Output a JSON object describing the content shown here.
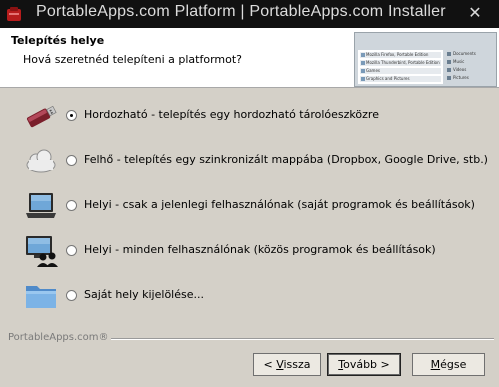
{
  "window": {
    "title": "PortableApps.com Platform | PortableApps.com Installer",
    "close_glyph": "✕"
  },
  "header": {
    "title": "Telepítés helye",
    "subtitle": "Hová szeretnéd telepíteni a platformot?",
    "preview": {
      "items": [
        "Mozilla Firefox, Portable Edition",
        "Mozilla Thunderbird, Portable Edition",
        "Games",
        "Graphics and Pictures"
      ],
      "side_items": [
        "Documents",
        "Music",
        "Videos",
        "Pictures"
      ]
    }
  },
  "options": [
    {
      "id": "portable",
      "label": "Hordozható - telepítés egy hordozható tárolóeszközre",
      "icon": "usb-drive-icon",
      "selected": true
    },
    {
      "id": "cloud",
      "label": "Felhő - telepítés egy szinkronizált mappába (Dropbox, Google Drive, stb.)",
      "icon": "cloud-icon",
      "selected": false
    },
    {
      "id": "local-user",
      "label": "Helyi - csak a jelenlegi felhasználónak (saját programok és beállítások)",
      "icon": "laptop-icon",
      "selected": false
    },
    {
      "id": "local-all",
      "label": "Helyi - minden felhasználónak (közös programok és beállítások)",
      "icon": "computer-users-icon",
      "selected": false
    },
    {
      "id": "custom",
      "label": "Saját hely kijelölése...",
      "icon": "folder-icon",
      "selected": false
    }
  ],
  "footer": {
    "brand": "PortableApps.com®",
    "back_button": {
      "pre": "< ",
      "accel": "V",
      "post": "issza"
    },
    "next_button": {
      "pre": "",
      "accel": "T",
      "post": "ovább >"
    },
    "cancel_button": {
      "pre": "",
      "accel": "M",
      "post": "égse"
    }
  },
  "colors": {
    "titlebar": "#111111",
    "header_bg": "#ffffff",
    "content_bg": "#d4d0c8"
  }
}
